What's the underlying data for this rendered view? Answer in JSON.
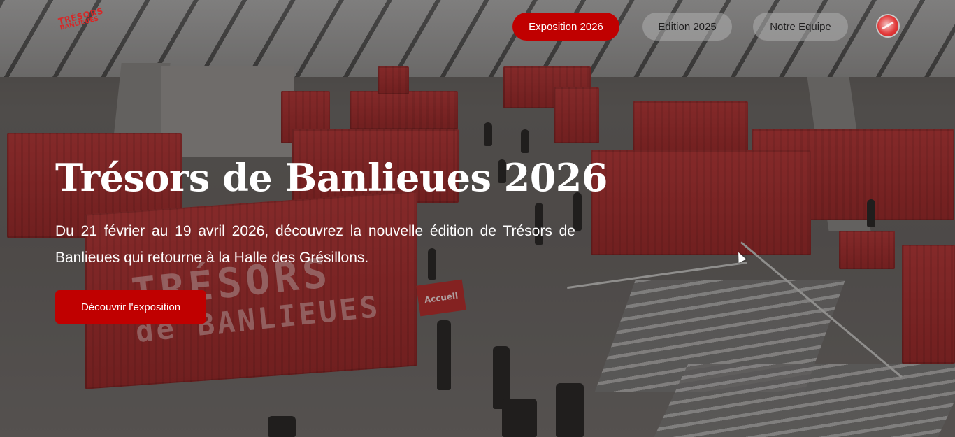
{
  "header": {
    "logo": {
      "line1": "TRÉSORS",
      "line2": "BANLIEUES"
    },
    "nav": [
      {
        "label": "Exposition 2026",
        "active": true
      },
      {
        "label": "Edition 2025",
        "active": false
      },
      {
        "label": "Notre Equipe",
        "active": false
      }
    ],
    "lang_icon": "language-flag-icon"
  },
  "hero": {
    "title": "Trésors de Banlieues 2026",
    "subtitle": "Du 21 février au 19 avril 2026, découvrez la nouvelle édition de Trésors de Banlieues qui retourne à la Halle des Grésillons.",
    "cta_label": "Découvrir l'exposition",
    "background": {
      "container_text_line1": "TRÉSORS",
      "container_text_line2": "de BANLIEUES",
      "sign": "Accueil"
    }
  },
  "colors": {
    "accent": "#c00000",
    "nav_inactive": "#afafaf",
    "text": "#ffffff"
  }
}
